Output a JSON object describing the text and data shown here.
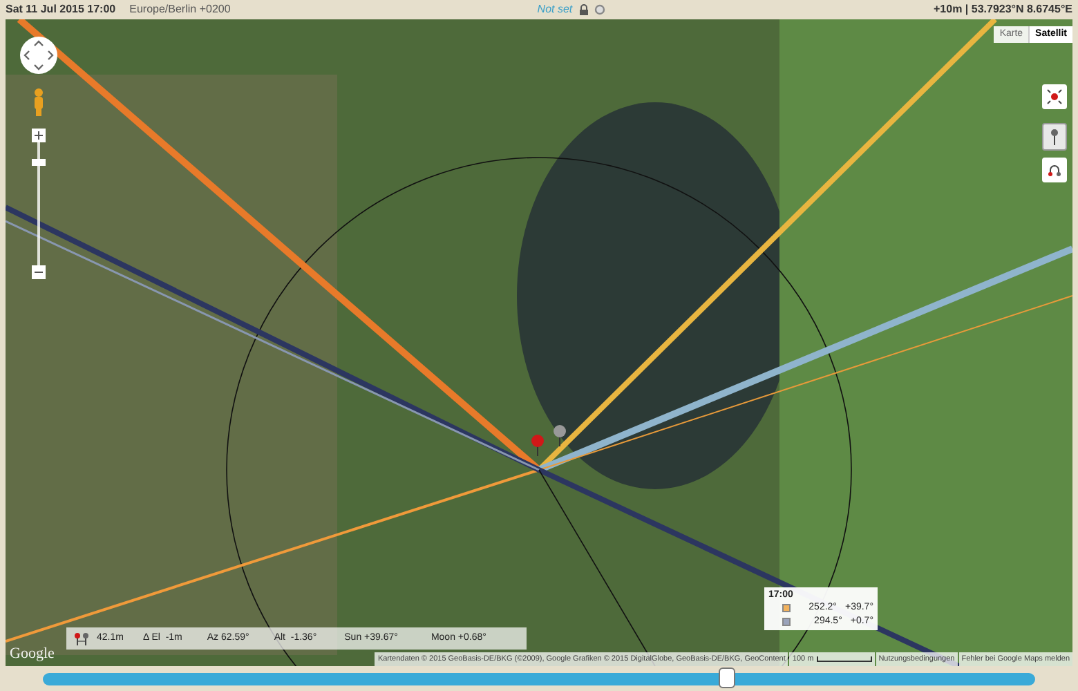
{
  "top_bar": {
    "date_time": "Sat 11 Jul 2015 17:00",
    "timezone": "Europe/Berlin +0200",
    "elevation_status": "Not set",
    "location": "+10m | 53.7923°N 8.6745°E"
  },
  "map_type_buttons": [
    {
      "label": "Karte",
      "selected": false
    },
    {
      "label": "Satellit",
      "selected": true
    }
  ],
  "info_bar": {
    "distance": "42.1m",
    "elevation_difference": "Δ El  -1m",
    "azimuth": "Az 62.59°",
    "altitude": "Alt  -1.36°",
    "sun": "Sun +39.67°",
    "moon": "Moon +0.68°"
  },
  "legend": {
    "time": "17:00",
    "rows": [
      {
        "color": "#f2b25c",
        "azimuth": "252.2°",
        "altitude": "+39.7°"
      },
      {
        "color": "#9aa3ba",
        "azimuth": "294.5°",
        "altitude": "+0.7°"
      }
    ]
  },
  "map_logo": "Google",
  "attribution": {
    "data": "Kartendaten © 2015 GeoBasis-DE/BKG (©2009), Google Grafiken © 2015 DigitalGlobe, GeoBasis-DE/BKG, GeoContent",
    "scale": "100 m",
    "terms": "Nutzungsbedingungen",
    "report": "Fehler bei Google Maps melden"
  },
  "time_slider": {
    "level": 0.69
  }
}
